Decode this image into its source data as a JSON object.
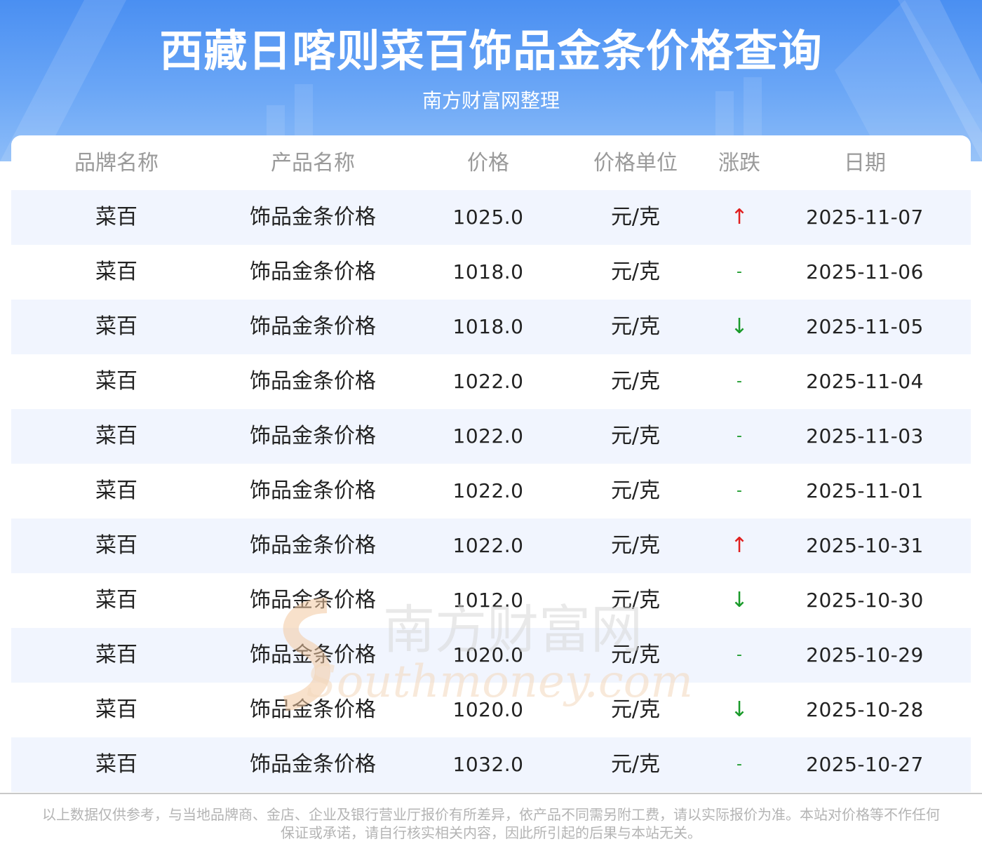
{
  "header": {
    "title": "西藏日喀则菜百饰品金条价格查询",
    "subtitle": "南方财富网整理"
  },
  "table": {
    "columns": [
      "品牌名称",
      "产品名称",
      "价格",
      "价格单位",
      "涨跌",
      "日期"
    ],
    "rows": [
      {
        "brand": "菜百",
        "product": "饰品金条价格",
        "price": "1025.0",
        "unit": "元/克",
        "trend": "↑",
        "trend_type": "up",
        "date": "2025-11-07"
      },
      {
        "brand": "菜百",
        "product": "饰品金条价格",
        "price": "1018.0",
        "unit": "元/克",
        "trend": "-",
        "trend_type": "flat",
        "date": "2025-11-06"
      },
      {
        "brand": "菜百",
        "product": "饰品金条价格",
        "price": "1018.0",
        "unit": "元/克",
        "trend": "↓",
        "trend_type": "down",
        "date": "2025-11-05"
      },
      {
        "brand": "菜百",
        "product": "饰品金条价格",
        "price": "1022.0",
        "unit": "元/克",
        "trend": "-",
        "trend_type": "flat",
        "date": "2025-11-04"
      },
      {
        "brand": "菜百",
        "product": "饰品金条价格",
        "price": "1022.0",
        "unit": "元/克",
        "trend": "-",
        "trend_type": "flat",
        "date": "2025-11-03"
      },
      {
        "brand": "菜百",
        "product": "饰品金条价格",
        "price": "1022.0",
        "unit": "元/克",
        "trend": "-",
        "trend_type": "flat",
        "date": "2025-11-01"
      },
      {
        "brand": "菜百",
        "product": "饰品金条价格",
        "price": "1022.0",
        "unit": "元/克",
        "trend": "↑",
        "trend_type": "up",
        "date": "2025-10-31"
      },
      {
        "brand": "菜百",
        "product": "饰品金条价格",
        "price": "1012.0",
        "unit": "元/克",
        "trend": "↓",
        "trend_type": "down",
        "date": "2025-10-30"
      },
      {
        "brand": "菜百",
        "product": "饰品金条价格",
        "price": "1020.0",
        "unit": "元/克",
        "trend": "-",
        "trend_type": "flat",
        "date": "2025-10-29"
      },
      {
        "brand": "菜百",
        "product": "饰品金条价格",
        "price": "1020.0",
        "unit": "元/克",
        "trend": "↓",
        "trend_type": "down",
        "date": "2025-10-28"
      },
      {
        "brand": "菜百",
        "product": "饰品金条价格",
        "price": "1032.0",
        "unit": "元/克",
        "trend": "-",
        "trend_type": "flat",
        "date": "2025-10-27"
      }
    ]
  },
  "watermark": {
    "line1": "南方财富网",
    "line2": "Southmoney.com"
  },
  "footer": {
    "disclaimer": "以上数据仅供参考，与当地品牌商、金店、企业及银行营业厅报价有所差异，依产品不同需另附工费，请以实际报价为准。本站对价格等不作任何保证或承诺，请自行核实相关内容，因此所引起的后果与本站无关。"
  },
  "colors": {
    "header_blue": "#4a8ff2",
    "row_stripe": "#f1f5fe",
    "up": "#e02020",
    "down": "#1a9a2a"
  }
}
